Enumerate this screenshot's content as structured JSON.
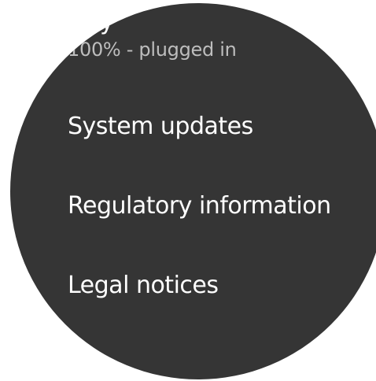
{
  "settings": {
    "items": [
      {
        "title": "tery",
        "subtitle": "100% - plugged in"
      },
      {
        "title": "System updates"
      },
      {
        "title": "Regulatory information"
      },
      {
        "title": "Legal notices"
      }
    ]
  },
  "colors": {
    "background": "#ffffff",
    "watch_face": "#353535",
    "title_text": "#ffffff",
    "subtitle_text": "#bdbdbd"
  }
}
